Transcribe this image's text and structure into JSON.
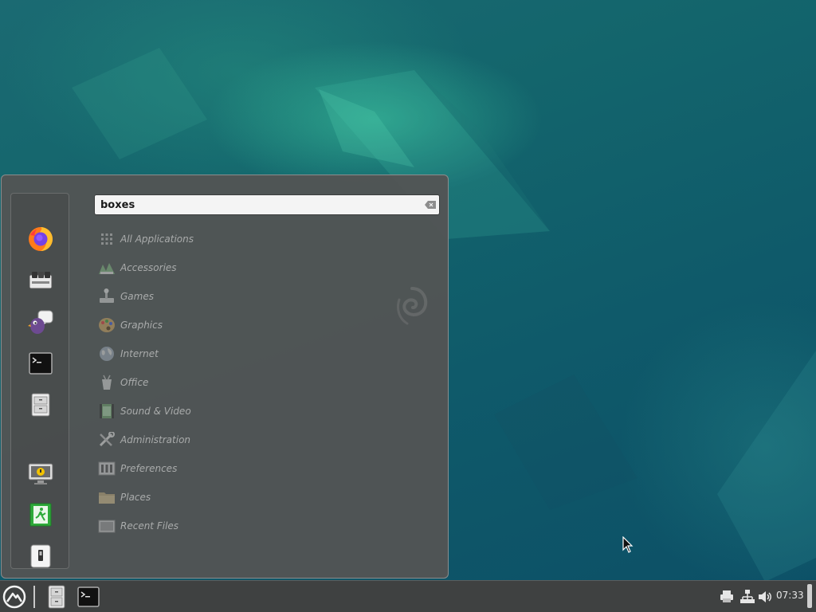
{
  "menu": {
    "search": {
      "value": "boxes",
      "placeholder": ""
    },
    "favorites": [
      {
        "name": "firefox-icon"
      },
      {
        "name": "software-manager-icon"
      },
      {
        "name": "pidgin-icon"
      },
      {
        "name": "terminal-icon"
      },
      {
        "name": "file-manager-icon"
      },
      {
        "name": "lock-screen-icon"
      },
      {
        "name": "logout-icon"
      },
      {
        "name": "shutdown-icon"
      }
    ],
    "categories": [
      {
        "label": "All Applications",
        "icon": "grid-icon"
      },
      {
        "label": "Accessories",
        "icon": "accessories-icon"
      },
      {
        "label": "Games",
        "icon": "games-icon"
      },
      {
        "label": "Graphics",
        "icon": "graphics-icon"
      },
      {
        "label": "Internet",
        "icon": "internet-icon"
      },
      {
        "label": "Office",
        "icon": "office-icon"
      },
      {
        "label": "Sound & Video",
        "icon": "sound-video-icon"
      },
      {
        "label": "Administration",
        "icon": "administration-icon"
      },
      {
        "label": "Preferences",
        "icon": "preferences-icon"
      },
      {
        "label": "Places",
        "icon": "folder-icon"
      },
      {
        "label": "Recent Files",
        "icon": "recent-files-icon"
      }
    ]
  },
  "taskbar": {
    "launchers": [
      {
        "name": "menu-button-icon"
      },
      {
        "name": "file-manager-icon"
      },
      {
        "name": "terminal-icon"
      }
    ],
    "tray": [
      {
        "name": "printer-icon"
      },
      {
        "name": "network-icon"
      },
      {
        "name": "volume-icon"
      }
    ],
    "clock": "07:33"
  },
  "colors": {
    "desktop_bg": "#13656c",
    "menu_bg": "#525454",
    "taskbar_bg": "#3f4141",
    "category_text": "#a9abab"
  }
}
